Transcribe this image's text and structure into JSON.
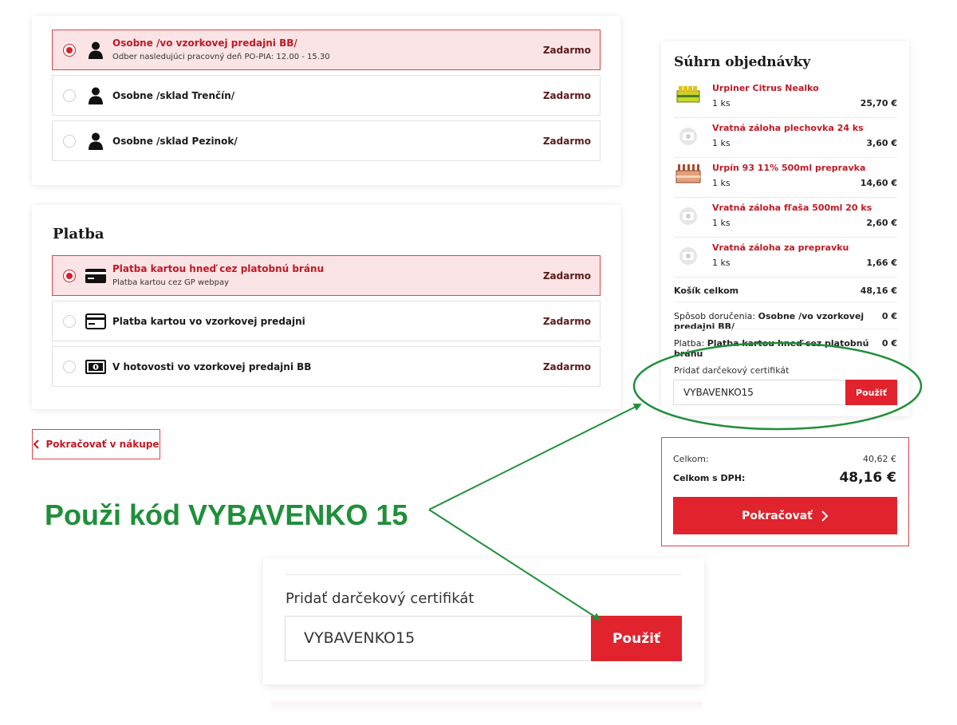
{
  "delivery": {
    "options": [
      {
        "title": "Osobne /vo vzorkovej predajni BB/",
        "subtitle": "Odber nasledujúci pracovný deň PO-PIA: 12.00 - 15.30",
        "price": "Zadarmo",
        "selected": true,
        "icon": "person-icon"
      },
      {
        "title": "Osobne /sklad Trenčín/",
        "subtitle": "",
        "price": "Zadarmo",
        "selected": false,
        "icon": "person-icon"
      },
      {
        "title": "Osobne /sklad Pezinok/",
        "subtitle": "",
        "price": "Zadarmo",
        "selected": false,
        "icon": "person-icon"
      }
    ]
  },
  "payment": {
    "heading": "Platba",
    "options": [
      {
        "title": "Platba kartou hneď cez platobnú bránu",
        "subtitle": "Platba kartou cez GP webpay",
        "price": "Zadarmo",
        "selected": true,
        "icon": "credit-card-icon"
      },
      {
        "title": "Platba kartou vo vzorkovej predajni",
        "subtitle": "",
        "price": "Zadarmo",
        "selected": false,
        "icon": "credit-card-icon"
      },
      {
        "title": "V hotovosti vo vzorkovej predajni BB",
        "subtitle": "",
        "price": "Zadarmo",
        "selected": false,
        "icon": "cash-icon"
      }
    ]
  },
  "continue_shopping": {
    "label": "Pokračovať v nákupe",
    "icon": "chevron-left-icon"
  },
  "summary": {
    "title": "Súhrn objednávky",
    "items": [
      {
        "name": "Urpiner Citrus Nealko",
        "qty": "1 ks",
        "price": "25,70 €",
        "thumb": "can-pack-thumbnail"
      },
      {
        "name": "Vratná záloha plechovka 24 ks",
        "qty": "1 ks",
        "price": "3,60 €",
        "thumb": "placeholder-camera-icon"
      },
      {
        "name": "Urpín 93 11% 500ml prepravka",
        "qty": "1 ks",
        "price": "14,60 €",
        "thumb": "bottle-crate-thumbnail"
      },
      {
        "name": "Vratná záloha fľaša 500ml 20 ks",
        "qty": "1 ks",
        "price": "2,60 €",
        "thumb": "placeholder-camera-icon"
      },
      {
        "name": "Vratná záloha za prepravku",
        "qty": "1 ks",
        "price": "1,66 €",
        "thumb": "placeholder-camera-icon"
      }
    ],
    "cart_total_label": "Košík celkom",
    "cart_total_value": "48,16 €",
    "delivery_label": "Spôsob doručenia:",
    "delivery_value": "Osobne /vo vzorkovej predajni BB/",
    "delivery_price": "0 €",
    "payment_label": "Platba:",
    "payment_value": "Platba kartou hneď cez platobnú bránu",
    "payment_price": "0 €",
    "gift_label": "Pridať darčekový certifikát",
    "gift_value": "VYBAVENKO15",
    "gift_button": "Použiť"
  },
  "totals": {
    "total_label": "Celkom:",
    "total_value": "40,62 €",
    "total_vat_label": "Celkom s DPH:",
    "total_vat_value": "48,16 €",
    "proceed_label": "Pokračovať"
  },
  "callout": {
    "text": "Použi kód VYBAVENKO 15",
    "color": "#1f8f3a"
  },
  "zoom": {
    "gift_label": "Pridať darčekový certifikát",
    "gift_value": "VYBAVENKO15",
    "gift_button": "Použiť"
  },
  "colors": {
    "accent": "#e0232c",
    "accent_dark": "#c01a25",
    "selected_bg": "#fbe4e6",
    "annotation": "#1f8f3a"
  }
}
